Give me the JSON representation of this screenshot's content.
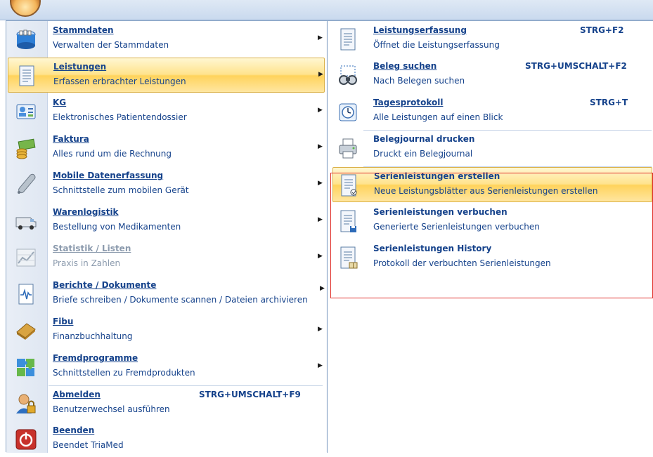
{
  "app": {
    "orb": "app-orb-icon"
  },
  "left_menu": [
    {
      "title": "Stammdaten",
      "desc": "Verwalten der Stammdaten",
      "icon": "database-icon",
      "arrow": true
    },
    {
      "title": "Leistungen",
      "desc": "Erfassen erbrachter Leistungen",
      "icon": "document-list-icon",
      "arrow": true,
      "active": true
    },
    {
      "title": "KG",
      "desc": "Elektronisches Patientendossier",
      "icon": "patient-card-icon",
      "arrow": true
    },
    {
      "title": "Faktura",
      "desc": "Alles rund um die Rechnung",
      "icon": "money-icon",
      "arrow": true
    },
    {
      "title": "Mobile Datenerfassung",
      "desc": "Schnittstelle zum mobilen Gerät",
      "icon": "pen-icon",
      "arrow": true
    },
    {
      "title": "Warenlogistik",
      "desc": "Bestellung von Medikamenten",
      "icon": "van-icon",
      "arrow": true
    },
    {
      "title": "Statistik / Listen",
      "desc": "Praxis in Zahlen",
      "icon": "chart-icon",
      "arrow": true,
      "disabled": true
    },
    {
      "title": "Berichte / Dokumente",
      "desc": "Briefe schreiben / Dokumente scannen / Dateien archivieren",
      "icon": "report-icon",
      "arrow": true
    },
    {
      "title": "Fibu",
      "desc": "Finanzbuchhaltung",
      "icon": "ledger-icon",
      "arrow": true
    },
    {
      "title": "Fremdprogramme",
      "desc": "Schnittstellen zu Fremdprodukten",
      "icon": "puzzle-icon",
      "arrow": true
    },
    {
      "title": "Abmelden",
      "desc": "Benutzerwechsel ausführen",
      "icon": "user-lock-icon",
      "shortcut": "STRG+UMSCHALT+F9"
    },
    {
      "title": "Beenden",
      "desc": "Beendet TriaMed",
      "icon": "power-icon"
    }
  ],
  "right_menu": [
    {
      "title": "Leistungserfassung",
      "desc": "Öffnet die Leistungserfassung",
      "icon": "document-icon",
      "shortcut": "STRG+F2"
    },
    {
      "title": "Beleg suchen",
      "desc": "Nach Belegen suchen",
      "icon": "binoculars-icon",
      "shortcut": "STRG+UMSCHALT+F2"
    },
    {
      "title": "Tagesprotokoll",
      "desc": "Alle Leistungen auf einen Blick",
      "icon": "clock-icon",
      "shortcut": "STRG+T"
    },
    {
      "title": "Belegjournal drucken",
      "desc": "Druckt ein Belegjournal",
      "icon": "printer-icon"
    },
    {
      "title": "Serienleistungen erstellen",
      "desc": "Neue Leistungsblätter aus Serienleistungen erstellen",
      "icon": "series-create-icon",
      "active": true
    },
    {
      "title": "Serienleistungen verbuchen",
      "desc": "Generierte Serienleistungen verbuchen",
      "icon": "series-post-icon"
    },
    {
      "title": "Serienleistungen History",
      "desc": "Protokoll der verbuchten Serienleistungen",
      "icon": "series-history-icon"
    }
  ],
  "colors": {
    "highlight": "#ffd35c",
    "text": "#15428b",
    "selection_box": "#e0302a"
  }
}
